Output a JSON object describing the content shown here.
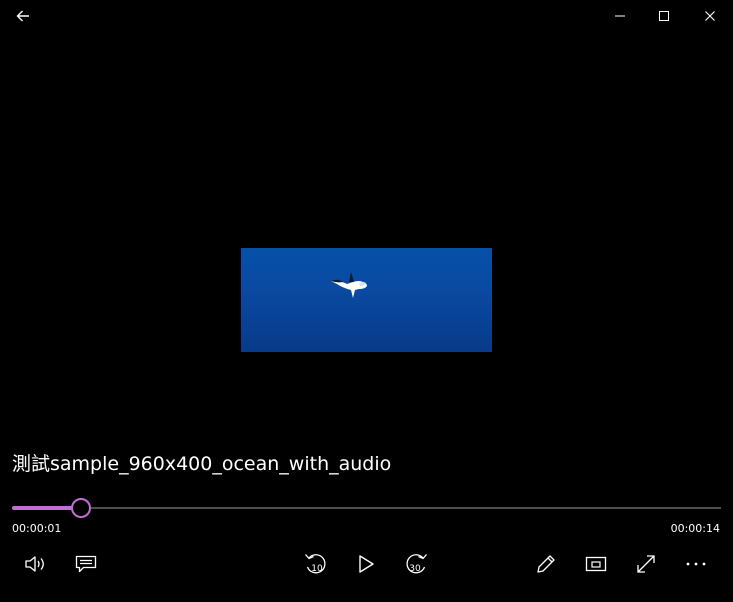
{
  "media": {
    "title": "測試sample_960x400_ocean_with_audio",
    "current_time": "00:00:01",
    "total_time": "00:00:14",
    "progress_fraction": 0.098
  },
  "controls": {
    "rewind_seconds": "10",
    "forward_seconds": "30"
  },
  "icons": {
    "back": "back-arrow-icon",
    "minimize": "minimize-icon",
    "maximize": "maximize-icon",
    "close": "close-icon",
    "volume": "volume-icon",
    "captions": "captions-icon",
    "rewind": "rewind-10-icon",
    "play": "play-icon",
    "forward": "forward-30-icon",
    "edit": "pencil-icon",
    "miniview": "mini-view-icon",
    "fullscreen": "fullscreen-icon",
    "more": "more-options-icon"
  },
  "colors": {
    "accent": "#c06dd4",
    "background": "#000000",
    "track": "#4d4d4d"
  }
}
